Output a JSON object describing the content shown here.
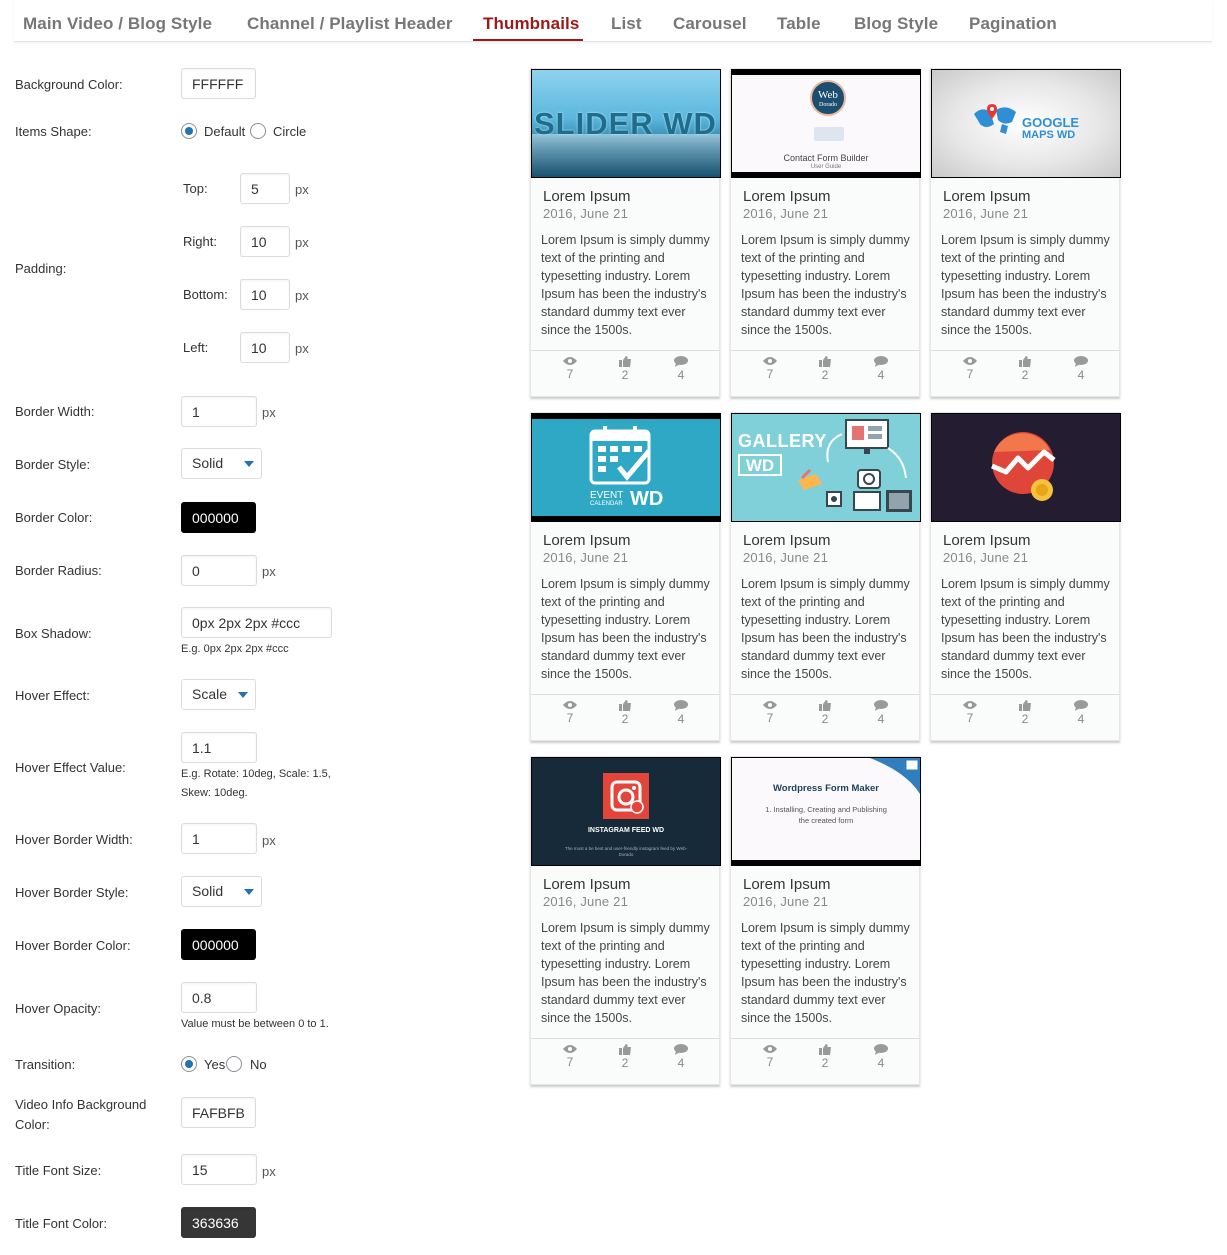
{
  "tabs": [
    {
      "label": "Main Video / Blog Style"
    },
    {
      "label": "Channel / Playlist Header"
    },
    {
      "label": "Thumbnails",
      "active": true
    },
    {
      "label": "List"
    },
    {
      "label": "Carousel"
    },
    {
      "label": "Table"
    },
    {
      "label": "Blog Style"
    },
    {
      "label": "Pagination"
    }
  ],
  "settings": {
    "background_color": {
      "label": "Background Color:",
      "value": "FFFFFF"
    },
    "items_shape": {
      "label": "Items Shape:",
      "options": [
        "Default",
        "Circle"
      ],
      "selected": "Default"
    },
    "padding": {
      "label": "Padding:",
      "top": {
        "label": "Top:",
        "value": "5"
      },
      "right": {
        "label": "Right:",
        "value": "10"
      },
      "bottom": {
        "label": "Bottom:",
        "value": "10"
      },
      "left": {
        "label": "Left:",
        "value": "10"
      },
      "unit": "px"
    },
    "border_width": {
      "label": "Border Width:",
      "value": "1",
      "unit": "px"
    },
    "border_style": {
      "label": "Border Style:",
      "value": "Solid"
    },
    "border_color": {
      "label": "Border Color:",
      "value": "000000"
    },
    "border_radius": {
      "label": "Border Radius:",
      "value": "0",
      "unit": "px"
    },
    "box_shadow": {
      "label": "Box Shadow:",
      "value": "0px 2px 2px #ccc",
      "hint": "E.g. 0px 2px 2px #ccc"
    },
    "hover_effect": {
      "label": "Hover Effect:",
      "value": "Scale"
    },
    "hover_effect_value": {
      "label": "Hover Effect Value:",
      "value": "1.1",
      "hint1": "E.g. Rotate: 10deg, Scale: 1.5,",
      "hint2": "Skew: 10deg."
    },
    "hover_border_width": {
      "label": "Hover Border Width:",
      "value": "1",
      "unit": "px"
    },
    "hover_border_style": {
      "label": "Hover Border Style:",
      "value": "Solid"
    },
    "hover_border_color": {
      "label": "Hover Border Color:",
      "value": "000000"
    },
    "hover_opacity": {
      "label": "Hover Opacity:",
      "value": "0.8",
      "hint": "Value must be between 0 to 1."
    },
    "transition": {
      "label": "Transition:",
      "options": [
        "Yes",
        "No"
      ],
      "selected": "Yes"
    },
    "video_info_bg": {
      "label1": "Video Info Background",
      "label2": "Color:",
      "value": "FAFBFB"
    },
    "title_font_size": {
      "label": "Title Font Size:",
      "value": "15",
      "unit": "px"
    },
    "title_font_color": {
      "label": "Title Font Color:",
      "value": "363636"
    }
  },
  "colors": {
    "accent": "#9e1a1a",
    "radio": "#2271b1",
    "card_bg": "#fafbfb",
    "title": "#363636"
  },
  "cards": [
    {
      "thumb": "slider-wd",
      "title": "Lorem Ipsum",
      "date": "2016, June 21",
      "desc": "Lorem Ipsum is simply dummy text of the printing and typesetting industry. Lorem Ipsum has been the industry's standard dummy text ever since the 1500s.",
      "views": "7",
      "likes": "2",
      "comments": "4"
    },
    {
      "thumb": "contact-form-builder",
      "title": "Lorem Ipsum",
      "date": "2016, June 21",
      "desc": "Lorem Ipsum is simply dummy text of the printing and typesetting industry. Lorem Ipsum has been the industry's standard dummy text ever since the 1500s.",
      "views": "7",
      "likes": "2",
      "comments": "4"
    },
    {
      "thumb": "google-maps-wd",
      "title": "Lorem Ipsum",
      "date": "2016, June 21",
      "desc": "Lorem Ipsum is simply dummy text of the printing and typesetting industry. Lorem Ipsum has been the industry's standard dummy text ever since the 1500s.",
      "views": "7",
      "likes": "2",
      "comments": "4"
    },
    {
      "thumb": "event-calendar-wd",
      "title": "Lorem Ipsum",
      "date": "2016, June 21",
      "desc": "Lorem Ipsum is simply dummy text of the printing and typesetting industry. Lorem Ipsum has been the industry's standard dummy text ever since the 1500s.",
      "views": "7",
      "likes": "2",
      "comments": "4"
    },
    {
      "thumb": "gallery-wd",
      "title": "Lorem Ipsum",
      "date": "2016, June 21",
      "desc": "Lorem Ipsum is simply dummy text of the printing and typesetting industry. Lorem Ipsum has been the industry's standard dummy text ever since the 1500s.",
      "views": "7",
      "likes": "2",
      "comments": "4"
    },
    {
      "thumb": "analytics",
      "title": "Lorem Ipsum",
      "date": "2016, June 21",
      "desc": "Lorem Ipsum is simply dummy text of the printing and typesetting industry. Lorem Ipsum has been the industry's standard dummy text ever since the 1500s.",
      "views": "7",
      "likes": "2",
      "comments": "4"
    },
    {
      "thumb": "instagram-feed-wd",
      "title": "Lorem Ipsum",
      "date": "2016, June 21",
      "desc": "Lorem Ipsum is simply dummy text of the printing and typesetting industry. Lorem Ipsum has been the industry's standard dummy text ever since the 1500s.",
      "views": "7",
      "likes": "2",
      "comments": "4"
    },
    {
      "thumb": "form-maker",
      "title": "Lorem Ipsum",
      "date": "2016, June 21",
      "desc": "Lorem Ipsum is simply dummy text of the printing and typesetting industry. Lorem Ipsum has been the industry's standard dummy text ever since the 1500s.",
      "views": "7",
      "likes": "2",
      "comments": "4"
    }
  ],
  "thumb_text": {
    "slider": "SLIDER WD",
    "web": "Web",
    "dorado": "Dorado",
    "contact_form": "Contact Form Builder",
    "user_guide": "User Guide",
    "google": "GOOGLE",
    "maps": "MAPS WD",
    "event": "EVENT",
    "calendar": "CALENDAR",
    "wd": "WD",
    "gallery": "GALLERY",
    "instagram": "INSTAGRAM FEED WD",
    "instagram_sub": "The most a be best and user-friendly instagram feed by Web-Dorado",
    "form_maker": "Wordpress Form Maker",
    "form_maker_sub1": "1. Installing, Creating and Publishing",
    "form_maker_sub2": "the created form"
  }
}
